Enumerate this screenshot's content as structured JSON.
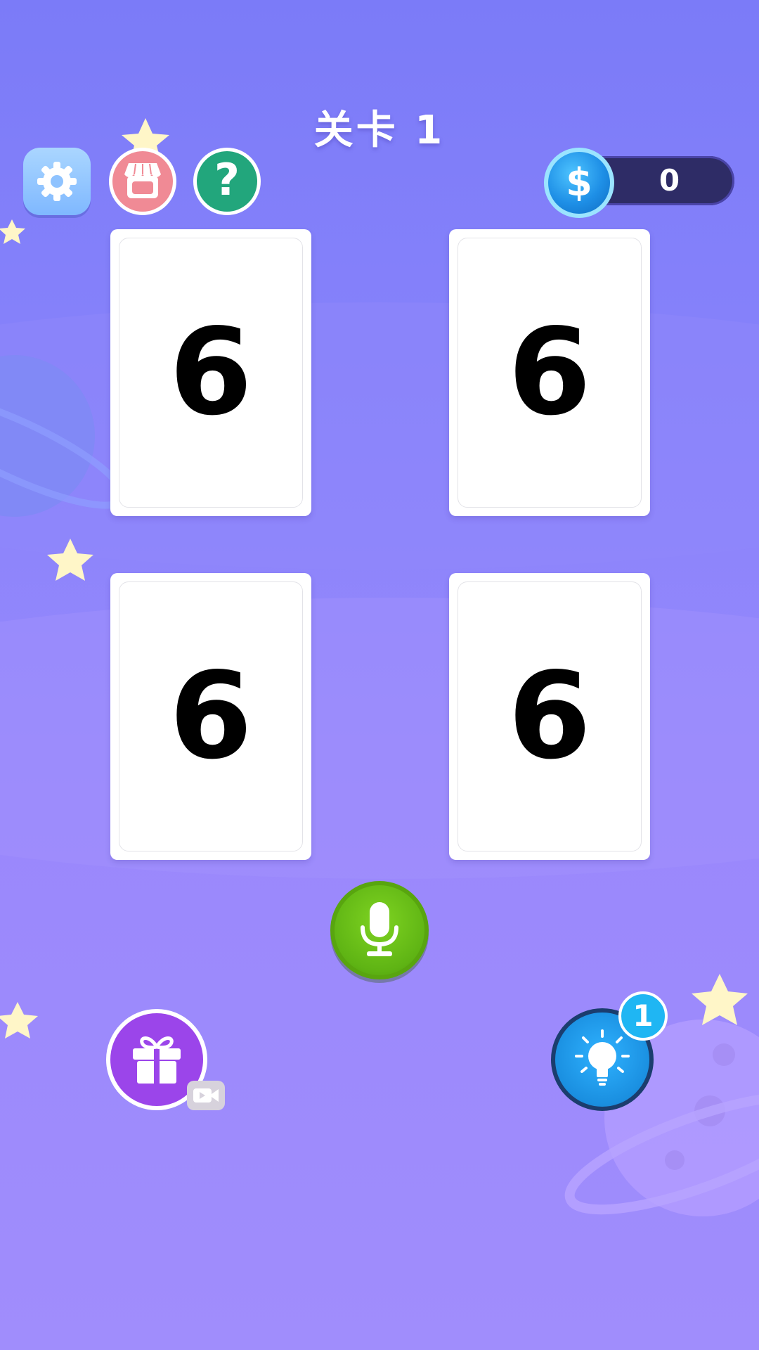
{
  "header": {
    "level_title": "关卡 1"
  },
  "top_bar": {
    "settings_icon": "gear-icon",
    "shop_icon": "shop-icon",
    "help_label": "?",
    "coin_symbol": "$",
    "coins": "0"
  },
  "cards": [
    {
      "value": "6"
    },
    {
      "value": "6"
    },
    {
      "value": "6"
    },
    {
      "value": "6"
    }
  ],
  "controls": {
    "mic_icon": "microphone-icon",
    "gift_icon": "gift-icon",
    "video_icon": "video-camera-icon",
    "hint_icon": "light-bulb-icon",
    "hint_count": "1"
  },
  "colors": {
    "background_top": "#7b7bf8",
    "background_bottom": "#a08dfc",
    "mic_green": "#6cc11a",
    "gift_purple": "#9b45ea",
    "hint_blue": "#1a8fe0"
  }
}
